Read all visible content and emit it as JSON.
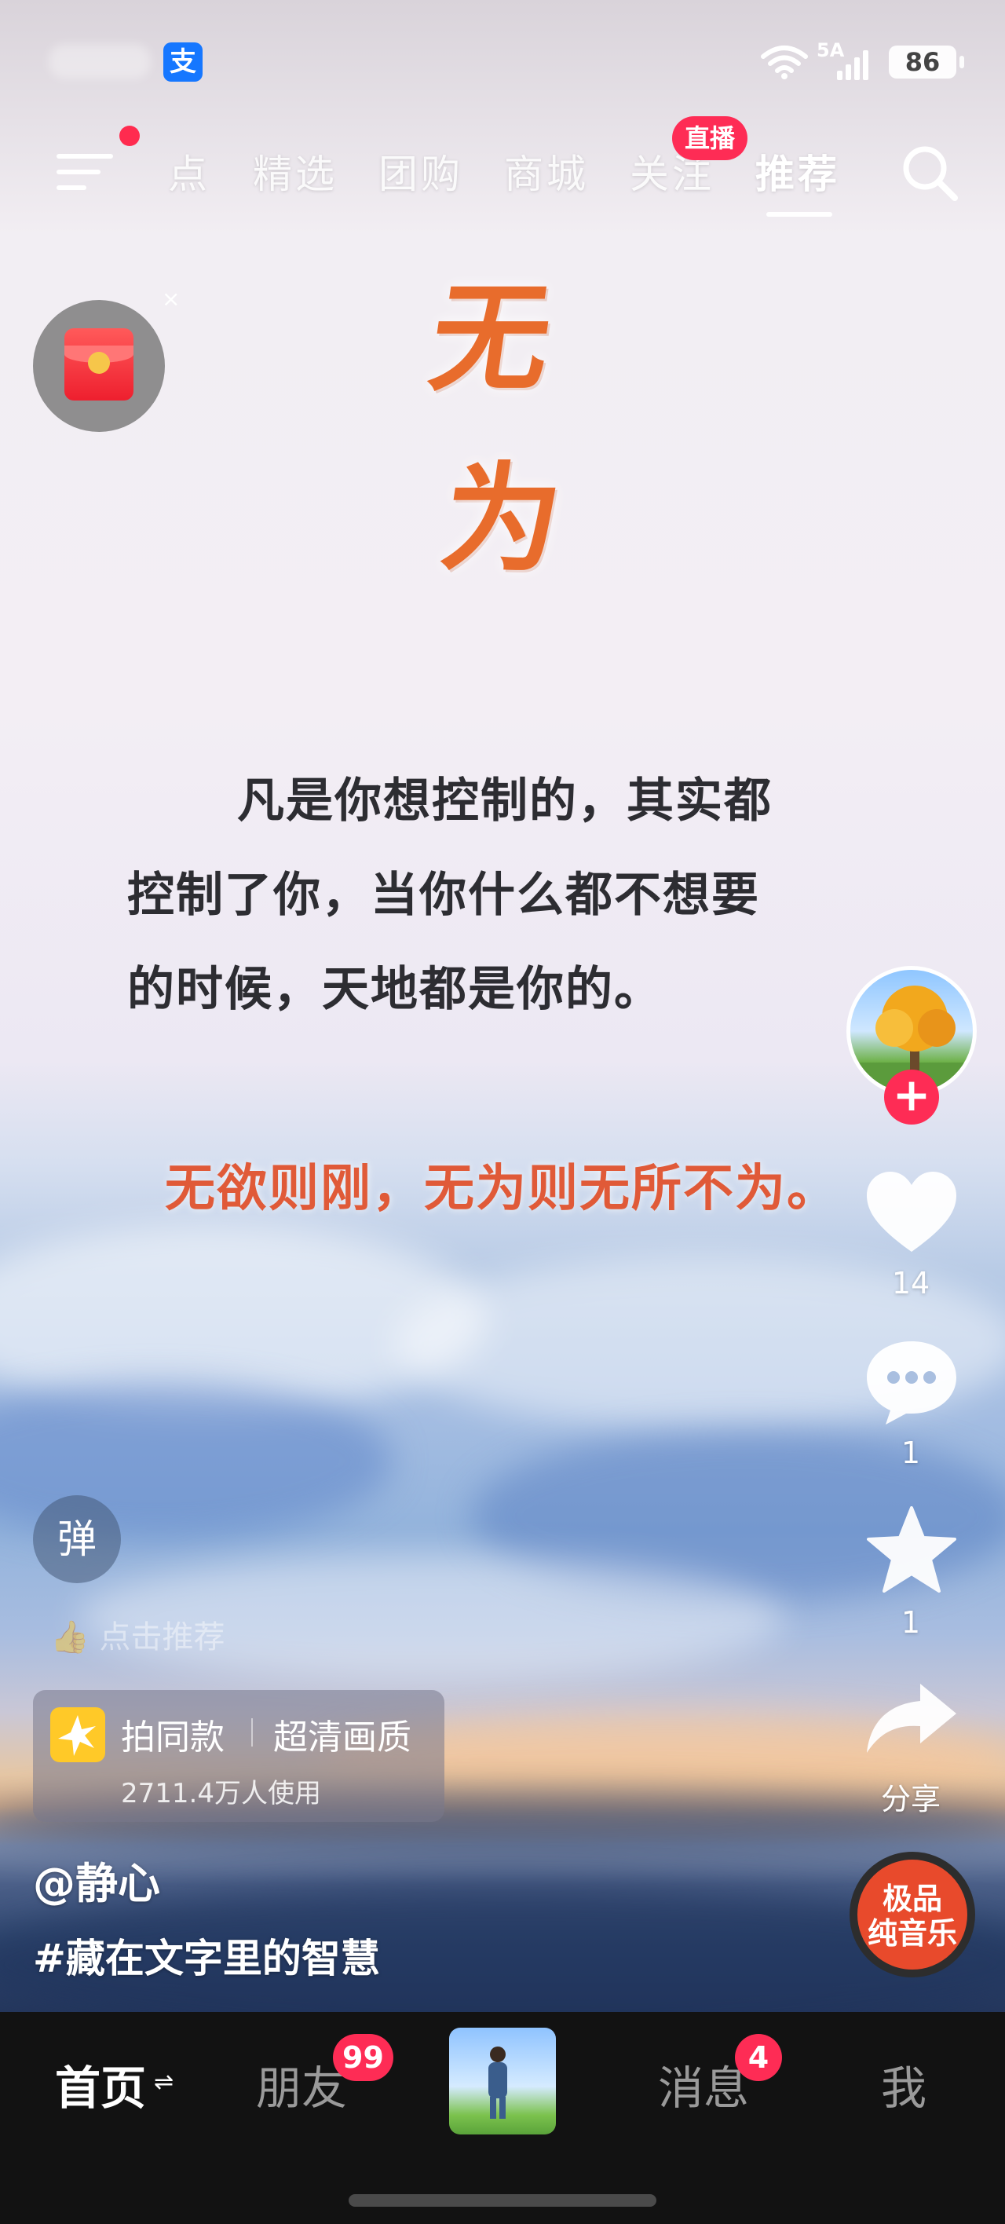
{
  "status_bar": {
    "app_icon": "alipay-icon",
    "app_icon_glyph": "支",
    "network_label": "5A",
    "battery": "86"
  },
  "top_nav": {
    "tabs": [
      "点",
      "精选",
      "团购",
      "商城",
      "关注",
      "推荐"
    ],
    "active_tab": "推荐",
    "live_badge": "直播"
  },
  "video": {
    "calligraphy_1": "无",
    "calligraphy_2": "为",
    "quote_lines": [
      "凡是你想控制的，其实都",
      "控制了你，当你什么都不想要",
      "的时候，天地都是你的。"
    ],
    "maxim": "无欲则刚，无为则无所不为。"
  },
  "actions": {
    "like_count": "14",
    "comment_count": "1",
    "favorite_count": "1",
    "share_label": "分享"
  },
  "overlay": {
    "danmu_label": "弹",
    "recommend_hint": "点击推荐",
    "template_title": "拍同款",
    "template_quality": "超清画质",
    "template_usage": "2711.4万人使用",
    "author": "@静心",
    "hashtag": "#藏在文字里的智慧",
    "music_label_1": "极品",
    "music_label_2": "纯音乐"
  },
  "bottom_nav": {
    "home": "首页",
    "home_refresh_glyph": "⇌",
    "friends": "朋友",
    "friends_badge": "99",
    "messages": "消息",
    "messages_badge": "4",
    "me": "我"
  },
  "colors": {
    "accent": "#fe2c55",
    "calligraphy": "#e86c2c",
    "maxim": "#e05a38",
    "alipay": "#1677ff"
  }
}
